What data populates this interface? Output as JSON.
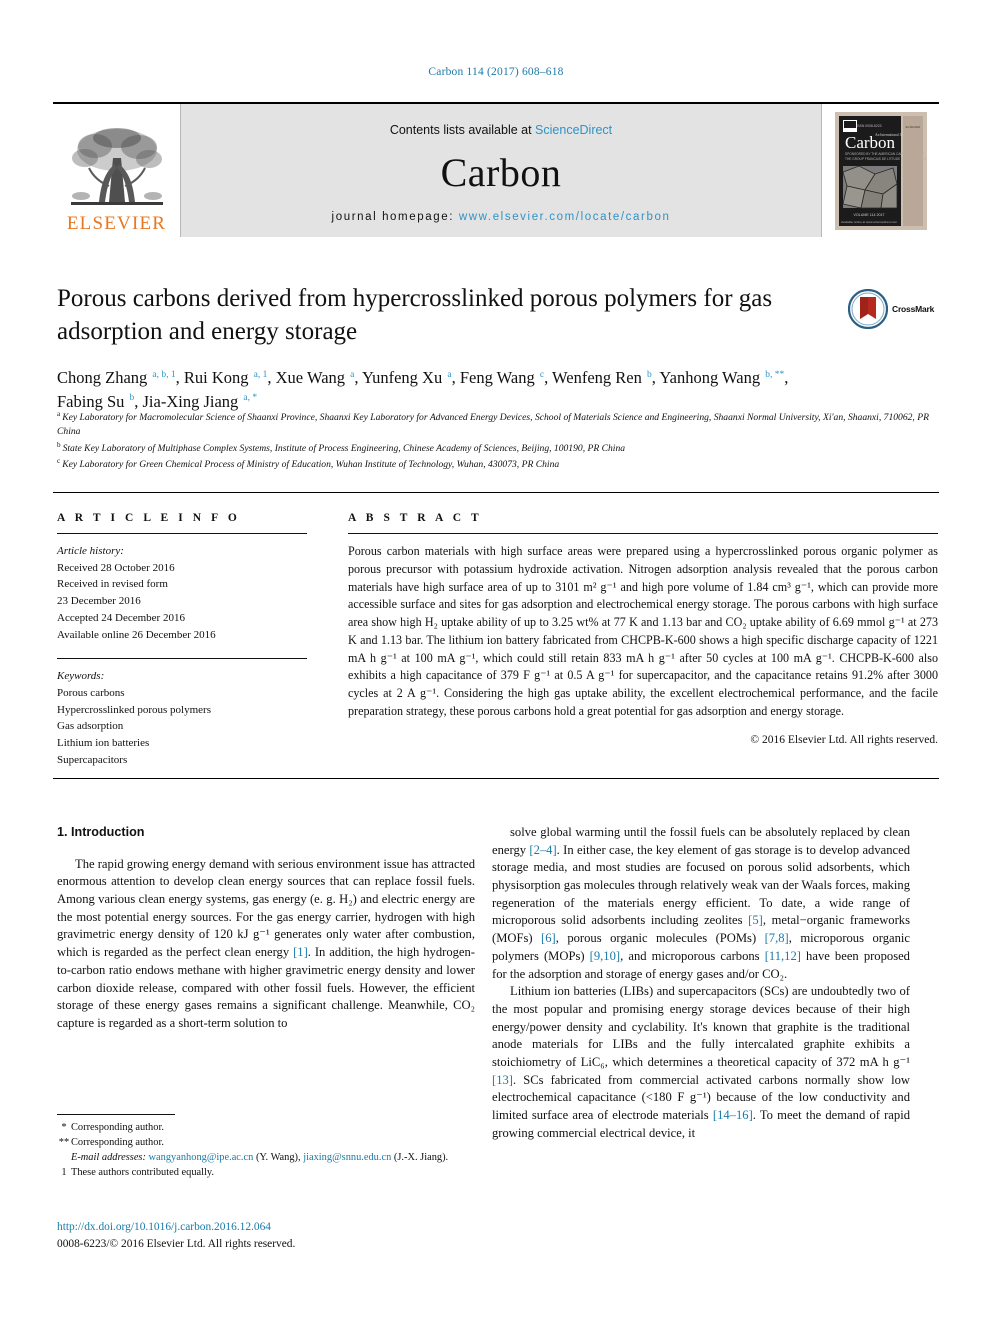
{
  "running_head": "Carbon 114 (2017) 608–618",
  "masthead": {
    "publisher_name": "ELSEVIER",
    "contents_prefix": "Contents lists available at ",
    "contents_link": "ScienceDirect",
    "journal_name": "Carbon",
    "homepage_label": "journal homepage: ",
    "homepage_url": "www.elsevier.com/locate/carbon",
    "cover_title": "Carbon"
  },
  "article": {
    "title": "Porous carbons derived from hypercrosslinked porous polymers for gas adsorption and energy storage",
    "crossmark_label": "CrossMark",
    "authors": [
      {
        "name": "Chong Zhang",
        "marks": "a, b, 1"
      },
      {
        "name": "Rui Kong",
        "marks": "a, 1"
      },
      {
        "name": "Xue Wang",
        "marks": "a"
      },
      {
        "name": "Yunfeng Xu",
        "marks": "a"
      },
      {
        "name": "Feng Wang",
        "marks": "c"
      },
      {
        "name": "Wenfeng Ren",
        "marks": "b"
      },
      {
        "name": "Yanhong Wang",
        "marks": "b, **"
      },
      {
        "name": "Fabing Su",
        "marks": "b"
      },
      {
        "name": "Jia-Xing Jiang",
        "marks": "a, *"
      }
    ],
    "affiliations": [
      {
        "mark": "a",
        "text": "Key Laboratory for Macromolecular Science of Shaanxi Province, Shaanxi Key Laboratory for Advanced Energy Devices, School of Materials Science and Engineering, Shaanxi Normal University, Xi'an, Shaanxi, 710062, PR China"
      },
      {
        "mark": "b",
        "text": "State Key Laboratory of Multiphase Complex Systems, Institute of Process Engineering, Chinese Academy of Sciences, Beijing, 100190, PR China"
      },
      {
        "mark": "c",
        "text": "Key Laboratory for Green Chemical Process of Ministry of Education, Wuhan Institute of Technology, Wuhan, 430073, PR China"
      }
    ]
  },
  "article_info": {
    "heading": "A R T I C L E  I N F O",
    "history_title": "Article history:",
    "history": [
      "Received 28 October 2016",
      "Received in revised form",
      "23 December 2016",
      "Accepted 24 December 2016",
      "Available online 26 December 2016"
    ],
    "keywords_title": "Keywords:",
    "keywords": [
      "Porous carbons",
      "Hypercrosslinked porous polymers",
      "Gas adsorption",
      "Lithium ion batteries",
      "Supercapacitors"
    ]
  },
  "abstract": {
    "heading": "A B S T R A C T",
    "text": "Porous carbon materials with high surface areas were prepared using a hypercrosslinked porous organic polymer as porous precursor with potassium hydroxide activation. Nitrogen adsorption analysis revealed that the porous carbon materials have high surface area of up to 3101 m² g⁻¹ and high pore volume of 1.84 cm³ g⁻¹, which can provide more accessible surface and sites for gas adsorption and electrochemical energy storage. The porous carbons with high surface area show high H₂ uptake ability of up to 3.25 wt% at 77 K and 1.13 bar and CO₂ uptake ability of 6.69 mmol g⁻¹ at 273 K and 1.13 bar. The lithium ion battery fabricated from CHCPB-K-600 shows a high specific discharge capacity of 1221 mA h g⁻¹ at 100 mA g⁻¹, which could still retain 833 mA h g⁻¹ after 50 cycles at 100 mA g⁻¹. CHCPB-K-600 also exhibits a high capacitance of 379 F g⁻¹ at 0.5 A g⁻¹ for supercapacitor, and the capacitance retains 91.2% after 3000 cycles at 2 A g⁻¹. Considering the high gas uptake ability, the excellent electrochemical performance, and the facile preparation strategy, these porous carbons hold a great potential for gas adsorption and energy storage.",
    "copyright": "© 2016 Elsevier Ltd. All rights reserved."
  },
  "body": {
    "section_number_title": "1. Introduction",
    "left_paragraph": "The rapid growing energy demand with serious environment issue has attracted enormous attention to develop clean energy sources that can replace fossil fuels. Among various clean energy systems, gas energy (e. g. H₂) and electric energy are the most potential energy sources. For the gas energy carrier, hydrogen with high gravimetric energy density of 120 kJ g⁻¹ generates only water after combustion, which is regarded as the perfect clean energy [1]. In addition, the high hydrogen-to-carbon ratio endows methane with higher gravimetric energy density and lower carbon dioxide release, compared with other fossil fuels. However, the efficient storage of these energy gases remains a significant challenge. Meanwhile, CO₂ capture is regarded as a short-term solution to",
    "right_paragraph_1": "solve global warming until the fossil fuels can be absolutely replaced by clean energy [2–4]. In either case, the key element of gas storage is to develop advanced storage media, and most studies are focused on porous solid adsorbents, which physisorption gas molecules through relatively weak van der Waals forces, making regeneration of the materials energy efficient. To date, a wide range of microporous solid adsorbents including zeolites [5], metal−organic frameworks (MOFs) [6], porous organic molecules (POMs) [7,8], microporous organic polymers (MOPs) [9,10], and microporous carbons [11,12] have been proposed for the adsorption and storage of energy gases and/or CO₂.",
    "right_paragraph_2": "Lithium ion batteries (LIBs) and supercapacitors (SCs) are undoubtedly two of the most popular and promising energy storage devices because of their high energy/power density and cyclability. It's known that graphite is the traditional anode materials for LIBs and the fully intercalated graphite exhibits a stoichiometry of LiC₆, which determines a theoretical capacity of 372 mA h g⁻¹ [13]. SCs fabricated from commercial activated carbons normally show low electrochemical capacitance (<180 F g⁻¹) because of the low conductivity and limited surface area of electrode materials [14–16]. To meet the demand of rapid growing commercial electrical device, it"
  },
  "footnotes": {
    "corresponding_1": "Corresponding author.",
    "corresponding_2": "Corresponding author.",
    "email_label": "E-mail addresses:",
    "email_1": "wangyanhong@ipe.ac.cn",
    "email_1_owner": "(Y. Wang)",
    "email_2": "jiaxing@snnu.edu.cn",
    "email_2_owner": "(J.-X. Jiang).",
    "equal_contrib_mark": "1",
    "equal_contrib": "These authors contributed equally.",
    "doi": "http://dx.doi.org/10.1016/j.carbon.2016.12.064",
    "issn_line": "0008-6223/© 2016 Elsevier Ltd. All rights reserved."
  }
}
